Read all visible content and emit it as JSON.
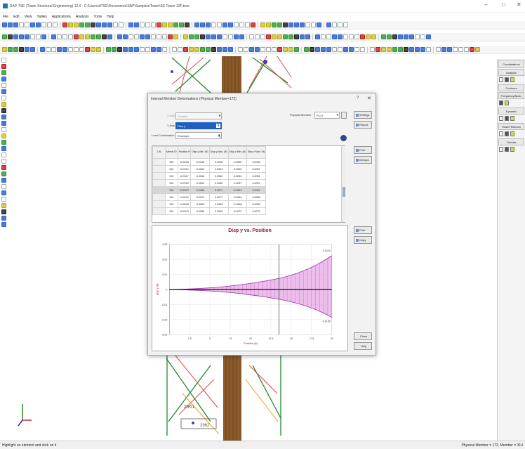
{
  "window": {
    "title": "SAP-TSE (Tower Structural Engineering) 12.0 - C:\\Users\\ATSE\\Documents\\SAP\\Samples\\Tower\\SE Tower 12F.tsse",
    "controls": [
      "–",
      "□",
      "✕"
    ]
  },
  "menu": [
    "File",
    "Edit",
    "View",
    "Tables",
    "Applications",
    "Analysis",
    "Tools",
    "Help"
  ],
  "right_panel": {
    "combinations": "Combinations",
    "analysis": "Analysis",
    "contours": "Contours",
    "frequency": "Frequency/Buck.",
    "dynamic": "Dynamic",
    "tower_telecom": "Tower/Telecom",
    "tubular": "Tubular"
  },
  "status": {
    "left": "Highlight an element and click on it",
    "right": "Physical Member = 172, Member = 314"
  },
  "canvas_labels": {
    "member_tag_1": "2961",
    "member_tag_2": "2962"
  },
  "dialog": {
    "title": "Internal Member Deformations (Physical Member=172)",
    "help": "?",
    "close": "✕",
    "x_axis_label": "X Axis",
    "x_axis_value": "Position",
    "y_axis_label": "Y Axis",
    "y_axis_value": "Disp y",
    "load_comb_label": "Load Combination",
    "load_comb_value": "Envelope",
    "phys_member_label": "Physical Member",
    "phys_member_value": "P172",
    "buttons": {
      "settings": "Settings",
      "report": "Report",
      "print": "Print",
      "interpol": "Interpol.",
      "print2": "Print",
      "copy": "Copy",
      "close": "Close",
      "help": "Help"
    },
    "table": {
      "headers": [
        "J\nAt",
        "Memb\nID",
        "Position\nft",
        "Disp y\nMin. (ft)",
        "Disp y\nMax. (ft)",
        "Disp z\nMin. (ft)",
        "Disp z\nMax. (ft)"
      ],
      "rows": [
        [
          "",
          "315",
          "11.5108",
          "-0.0048",
          "0.0048",
          "-0.0050",
          "0.0048"
        ],
        [
          "",
          "315",
          "12.0112",
          "-0.0053",
          "0.0054",
          "-0.0052",
          "0.0051"
        ],
        [
          "",
          "315",
          "12.5117",
          "-0.0058",
          "0.0060",
          "-0.0054",
          "0.0054"
        ],
        [
          "",
          "315",
          "13.0122",
          "-0.0063",
          "0.0065",
          "-0.0057",
          "0.0057"
        ],
        [
          "",
          "315",
          "13.5127",
          "-0.0068",
          "0.0071",
          "-0.0061",
          "0.0061"
        ],
        [
          "",
          "315",
          "14.0131",
          "-0.0074",
          "0.0077",
          "-0.0064",
          "0.0065"
        ],
        [
          "",
          "315",
          "14.5136",
          "-0.0080",
          "0.0083",
          "-0.0068",
          "0.0069"
        ],
        [
          "",
          "315",
          "15.0141",
          "-0.0086",
          "0.0089",
          "-0.0072",
          "0.0073"
        ]
      ],
      "highlight_row": 4
    }
  },
  "chart_data": {
    "type": "area",
    "title": "Disp y vs. Position",
    "xlabel": "Position (ft)",
    "ylabel": "Disp y (ft)",
    "xlim": [
      0,
      20
    ],
    "ylim": [
      -0.03,
      0.03
    ],
    "xticks": [
      "2.5",
      "5",
      "7.5",
      "10",
      "12.5",
      "15",
      "17.5",
      "20"
    ],
    "yticks": [
      "0.03",
      "0.02",
      "0.01",
      "0",
      "-0.01",
      "-0.02",
      "-0.03"
    ],
    "cursor_x": 13.5,
    "max_label": "0.0224",
    "min_label": "-0.0185",
    "x": [
      0,
      1,
      2,
      3,
      4,
      5,
      6,
      7,
      8,
      9,
      10,
      11,
      12,
      13,
      14,
      15,
      16,
      17,
      18,
      19,
      20
    ],
    "series": [
      {
        "name": "Max",
        "values": [
          0,
          0.0001,
          0.0003,
          0.0005,
          0.0008,
          0.0011,
          0.0015,
          0.002,
          0.0026,
          0.0033,
          0.004,
          0.0049,
          0.0058,
          0.0068,
          0.008,
          0.0095,
          0.0113,
          0.0135,
          0.016,
          0.019,
          0.0224
        ]
      },
      {
        "name": "Min",
        "values": [
          0,
          -0.0001,
          -0.0003,
          -0.0005,
          -0.0007,
          -0.001,
          -0.0014,
          -0.0018,
          -0.0023,
          -0.0029,
          -0.0036,
          -0.0043,
          -0.0051,
          -0.006,
          -0.007,
          -0.0082,
          -0.0096,
          -0.0113,
          -0.0133,
          -0.0157,
          -0.0185
        ]
      }
    ],
    "colors": {
      "fill": "#e7a8e6",
      "line": "#9b2fa5",
      "zero": "#2c1a2c",
      "title": "#8b1c3a"
    }
  }
}
